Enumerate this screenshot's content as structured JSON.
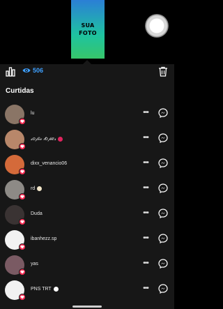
{
  "story": {
    "thumbnail_text_line1": "SUA",
    "thumbnail_text_line2": "FOTO"
  },
  "toolbar": {
    "views_count": "506"
  },
  "section": {
    "title": "Curtidas"
  },
  "likes": [
    {
      "name": "lu",
      "style": "plain",
      "avatar_color": "#8a7566",
      "emoji": ""
    },
    {
      "name": "𝓈𝑜𝒻𝒾𝒶 𝓁𝑜𝓅𝑒𝓈",
      "style": "script",
      "avatar_color": "#b8876a",
      "emoji": "#e0245e"
    },
    {
      "name": "dixx_venancio06",
      "style": "plain",
      "avatar_color": "#d46a3a",
      "emoji": ""
    },
    {
      "name": "rd",
      "style": "plain",
      "avatar_color": "#8d8a86",
      "emoji": "#f2e6c9"
    },
    {
      "name": "Duda",
      "style": "plain",
      "avatar_color": "#3a3333",
      "emoji": ""
    },
    {
      "name": "ibanhezz.sp",
      "style": "plain",
      "avatar_color": "#f2f2f2",
      "emoji": ""
    },
    {
      "name": "yas",
      "style": "plain",
      "avatar_color": "#7a5a63",
      "emoji": ""
    },
    {
      "name": "PNS TRT",
      "style": "plain",
      "avatar_color": "#f2f2f2",
      "emoji": "#ffffff"
    }
  ],
  "colors": {
    "accent": "#3ea0ff",
    "like_badge": "#ff2d55",
    "sheet_bg": "#171717"
  },
  "icons": {
    "stats": "bar-chart-icon",
    "views": "eye-icon",
    "delete": "trash-icon",
    "more": "more-horizontal-icon",
    "message": "messenger-icon",
    "badge": "heart-icon"
  }
}
